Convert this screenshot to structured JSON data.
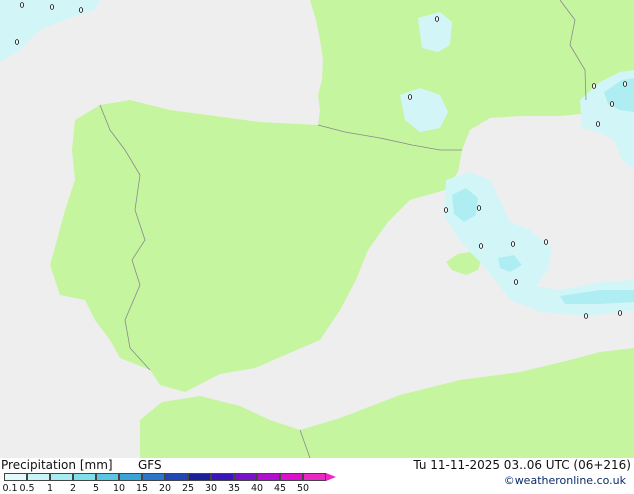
{
  "legend": {
    "title": "Precipitation [mm]",
    "model": "GFS",
    "valid_time": "Tu 11-11-2025 03..06 UTC (06+216)",
    "credit": "©weatheronline.co.uk",
    "scale_labels": [
      "0.1",
      "0.5",
      "1",
      "2",
      "5",
      "10",
      "15",
      "20",
      "25",
      "30",
      "35",
      "40",
      "45",
      "50"
    ],
    "scale_colors": [
      "#e4fbfc",
      "#c8f4f7",
      "#a6ecf2",
      "#7fe0ec",
      "#5ac6e3",
      "#3aa3d7",
      "#2b76cb",
      "#2046b8",
      "#1a1f9a",
      "#3b16b8",
      "#7a12c8",
      "#b20ed2",
      "#da10cc",
      "#ea28c4"
    ]
  },
  "map": {
    "colors": {
      "sea": "#eeeeee",
      "land": "#c6f5a0",
      "border": "#8a8a8a",
      "precip_light": "#d2f6f8",
      "precip_medium": "#aeeef3",
      "precip_heavy": "#7fdce9"
    }
  }
}
